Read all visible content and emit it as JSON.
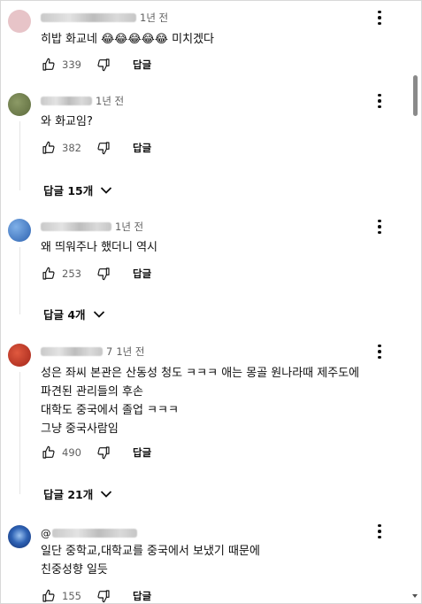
{
  "comments": [
    {
      "time": "1년 전",
      "text_lines": [
        "히밥 화교네 😂😂😂😂😂 미치겠다"
      ],
      "likes": "339",
      "reply_label": "답글",
      "replies_label": null,
      "avatar_color": "#e8c6c6"
    },
    {
      "time": "1년 전",
      "text_lines": [
        "와 화교임?"
      ],
      "likes": "382",
      "reply_label": "답글",
      "replies_label": "답글 15개",
      "avatar_color": "#6f7a4f"
    },
    {
      "time": "1년 전",
      "text_lines": [
        "왜 띄워주나 했더니 역시"
      ],
      "likes": "253",
      "reply_label": "답글",
      "replies_label": "답글 4개",
      "avatar_color": "#3a78c8"
    },
    {
      "handle_suffix": "7",
      "time": "1년 전",
      "text_lines": [
        "성은 좌씨  본관은 산동성 청도  ㅋㅋㅋ  애는 몽골 원나라때 제주도에",
        "파견된 관리들의 후손",
        "대학도 중국에서 졸업  ㅋㅋㅋ",
        "그냥 중국사람임"
      ],
      "likes": "490",
      "reply_label": "답글",
      "replies_label": "답글 21개",
      "avatar_color": "#c0392b"
    },
    {
      "handle_prefix": "@",
      "time": "",
      "text_lines": [
        "일단 중학교,대학교를 중국에서 보냈기 때문에",
        "친중성향 일듯"
      ],
      "likes": "155",
      "reply_label": "답글",
      "replies_label": null,
      "avatar_color": "#1f4fa8"
    }
  ]
}
